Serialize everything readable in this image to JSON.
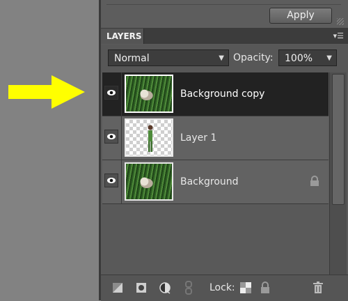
{
  "toolbar": {
    "apply_label": "Apply"
  },
  "panel": {
    "tab_label": "LAYERS",
    "menu_icon": "panel-menu-icon"
  },
  "blend": {
    "mode": "Normal",
    "opacity_label": "Opacity:",
    "opacity_value": "100%"
  },
  "layers": [
    {
      "name": "Background copy",
      "selected": true,
      "visible": true,
      "locked": false
    },
    {
      "name": "Layer 1",
      "selected": false,
      "visible": true,
      "locked": false
    },
    {
      "name": "Background",
      "selected": false,
      "visible": true,
      "locked": true
    }
  ],
  "footer": {
    "lock_label": "Lock:"
  },
  "colors": {
    "selected_row": "#222222",
    "arrow": "#ffff00",
    "panel_bg": "#5a5a5a"
  }
}
